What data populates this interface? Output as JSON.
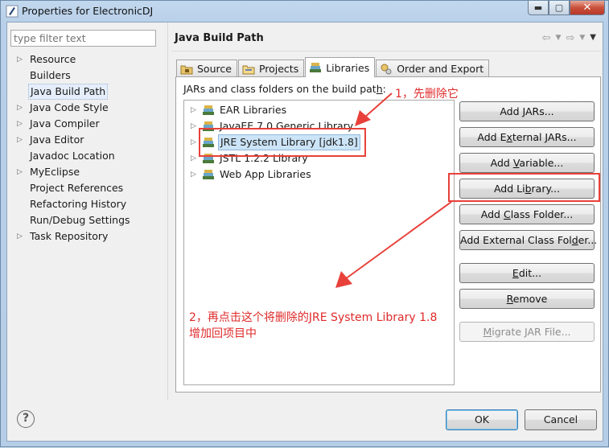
{
  "window": {
    "title": "Properties for ElectronicDJ",
    "minimize_glyph": "▬",
    "maximize_glyph": "▢",
    "close_glyph": "✕"
  },
  "sidebar": {
    "filter_placeholder": "type filter text",
    "items": [
      {
        "label": "Resource",
        "expandable": true
      },
      {
        "label": "Builders",
        "expandable": false
      },
      {
        "label": "Java Build Path",
        "expandable": false,
        "selected": true
      },
      {
        "label": "Java Code Style",
        "expandable": true
      },
      {
        "label": "Java Compiler",
        "expandable": true
      },
      {
        "label": "Java Editor",
        "expandable": true
      },
      {
        "label": "Javadoc Location",
        "expandable": false
      },
      {
        "label": "MyEclipse",
        "expandable": true
      },
      {
        "label": "Project References",
        "expandable": false
      },
      {
        "label": "Refactoring History",
        "expandable": false
      },
      {
        "label": "Run/Debug Settings",
        "expandable": false
      },
      {
        "label": "Task Repository",
        "expandable": true
      }
    ]
  },
  "page": {
    "title": "Java Build Path",
    "tabs": [
      {
        "label": "Source",
        "icon": "source-folder-icon"
      },
      {
        "label": "Projects",
        "icon": "projects-icon"
      },
      {
        "label": "Libraries",
        "icon": "library-icon",
        "active": true
      },
      {
        "label": "Order and Export",
        "icon": "order-export-icon"
      }
    ],
    "libraries_label_pre": "JARs and class folders on the build pat",
    "libraries_label_mnemonic": "h",
    "libraries_label_post": ":",
    "libraries": [
      {
        "label": "EAR Libraries"
      },
      {
        "label": "JavaEE 7.0 Generic Library"
      },
      {
        "label": "JRE System Library [jdk1.8]",
        "selected": true
      },
      {
        "label": "JSTL 1.2.2 Library"
      },
      {
        "label": "Web App Libraries"
      }
    ],
    "buttons": [
      {
        "pre": "Add ",
        "mn": "J",
        "post": "ARs...",
        "enabled": true
      },
      {
        "pre": "Add E",
        "mn": "x",
        "post": "ternal JARs...",
        "enabled": true
      },
      {
        "pre": "Add ",
        "mn": "V",
        "post": "ariable...",
        "enabled": true
      },
      {
        "pre": "Add Li",
        "mn": "b",
        "post": "rary...",
        "enabled": true
      },
      {
        "pre": "Add ",
        "mn": "C",
        "post": "lass Folder...",
        "enabled": true
      },
      {
        "pre": "Add External Class Fol",
        "mn": "d",
        "post": "er...",
        "enabled": true
      },
      {
        "pre": "",
        "mn": "E",
        "post": "dit...",
        "enabled": true
      },
      {
        "pre": "",
        "mn": "R",
        "post": "emove",
        "enabled": true
      },
      {
        "pre": "",
        "mn": "M",
        "post": "igrate JAR File...",
        "enabled": false
      }
    ]
  },
  "footer": {
    "help_glyph": "?",
    "ok_label": "OK",
    "cancel_label": "Cancel"
  },
  "annotations": {
    "step1": "1，先删除它",
    "step2_line1": "2，再点击这个将删除的JRE System Library 1.8",
    "step2_line2": "增加回项目中"
  },
  "colors": {
    "annotation_red": "#e8413a",
    "selection_blue": "#cce4f7"
  }
}
